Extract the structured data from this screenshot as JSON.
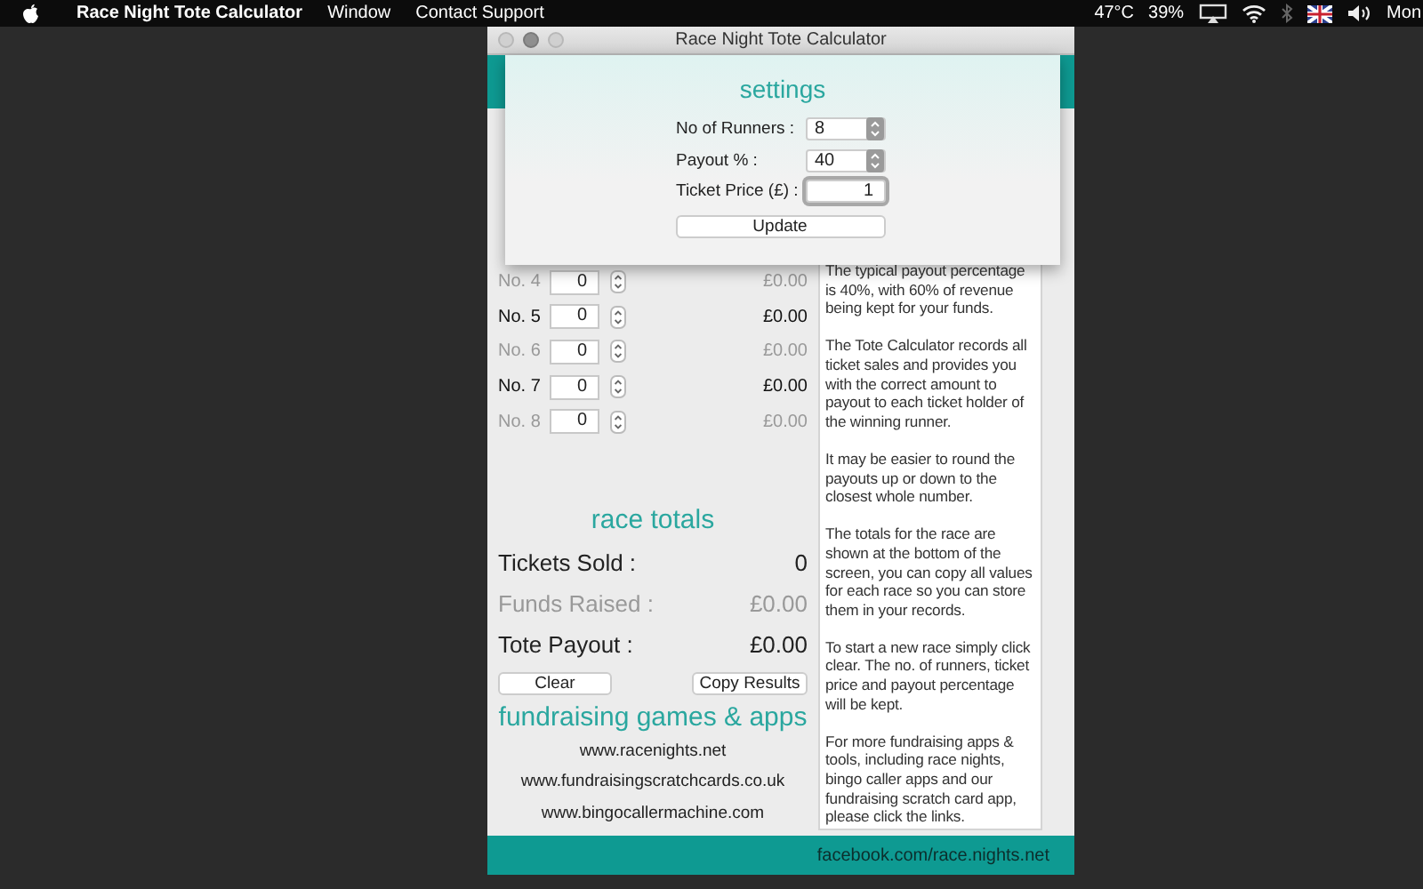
{
  "menu_bar": {
    "app_name": "Race Night Tote Calculator",
    "menus": [
      "Window",
      "Contact Support"
    ],
    "temperature": "47°C",
    "battery": "39%",
    "clock": "Mon"
  },
  "window": {
    "title": "Race Night Tote Calculator"
  },
  "settings": {
    "heading": "settings",
    "fields": [
      {
        "label": "No of Runners :",
        "value": "8",
        "kind": "stepper",
        "focused": false
      },
      {
        "label": "Payout % :",
        "value": "40",
        "kind": "stepper",
        "focused": false
      },
      {
        "label": "Ticket Price (£) :",
        "value": "1",
        "kind": "text",
        "focused": true
      }
    ],
    "button": "Update"
  },
  "runners": [
    {
      "label": "No. 4",
      "tickets": "0",
      "payout": "£0.00",
      "dimmed": true
    },
    {
      "label": "No. 5",
      "tickets": "0",
      "payout": "£0.00",
      "dimmed": false
    },
    {
      "label": "No. 6",
      "tickets": "0",
      "payout": "£0.00",
      "dimmed": true
    },
    {
      "label": "No. 7",
      "tickets": "0",
      "payout": "£0.00",
      "dimmed": false
    },
    {
      "label": "No. 8",
      "tickets": "0",
      "payout": "£0.00",
      "dimmed": true
    }
  ],
  "totals": {
    "heading": "race totals",
    "rows": [
      {
        "label": "Tickets Sold :",
        "value": "0",
        "dimmed": false
      },
      {
        "label": "Funds Raised :",
        "value": "£0.00",
        "dimmed": true
      },
      {
        "label": "Tote Payout :",
        "value": "£0.00",
        "dimmed": false
      }
    ],
    "buttons": [
      "Clear",
      "Copy Results"
    ]
  },
  "links": {
    "heading": "fundraising games & apps",
    "items": [
      "www.racenights.net",
      "www.fundraisingscratchcards.co.uk",
      "www.bingocallermachine.com"
    ]
  },
  "info_text": [
    "The typical payout percentage is 40%, with 60% of revenue being kept for your funds.",
    "The Tote Calculator records all ticket sales and provides you with the correct amount to payout to each ticket holder of the winning runner.",
    "It may be easier to round the payouts up or down to the closest whole number.",
    "The totals for the race are shown at the bottom of the screen, you can copy all values for each race so you can store them in your records.",
    "To start a new race simply click clear.  The no. of runners, ticket price and payout percentage will be kept.",
    "For more fundraising apps & tools, including race nights, bingo caller apps and our fundraising scratch card app, please click the links."
  ],
  "footer": {
    "link": "facebook.com/race.nights.net"
  }
}
